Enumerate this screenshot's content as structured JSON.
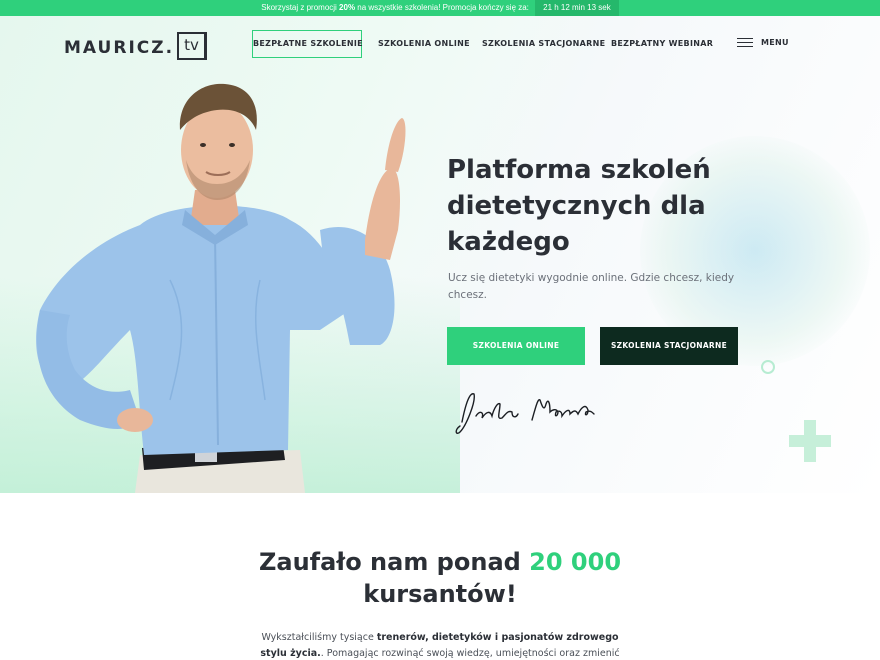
{
  "promo": {
    "text_before": "Skorzystaj z promocji ",
    "discount": "20%",
    "text_after": " na wszystkie szkolenia! Promocja kończy się za:",
    "timer": "21 h 12 min 13 sek"
  },
  "header": {
    "logo_word": "MAURICZ.",
    "logo_tv": "tv",
    "nav": {
      "free_training": "BEZPŁATNE SZKOLENIE",
      "online": "SZKOLENIA  ONLINE",
      "stationary": "SZKOLENIA STACJONARNE",
      "webinar": "BEZPŁATNY WEBINAR",
      "menu": "MENU"
    }
  },
  "hero": {
    "title": "Platforma szkoleń dietetycznych dla każdego",
    "subtitle": "Ucz się dietetyki wygodnie online. Gdzie chcesz, kiedy chcesz.",
    "btn_online": "SZKOLENIA ONLINE",
    "btn_stationary": "SZKOLENIA STACJONARNE"
  },
  "trust": {
    "title_start": "Zaufało nam ponad ",
    "title_number": "20 000",
    "title_end": " kursantów!",
    "text_start": "Wykształciliśmy tysiące ",
    "text_bold": "trenerów, dietetyków i pasjonatów zdrowego stylu życia.",
    "text_end": ". Pomagając rozwinąć swoją wiedzę, umiejętności oraz zmienić swoje"
  },
  "colors": {
    "accent": "#2fd07c",
    "dark_button": "#0d2a1f",
    "text": "#2b2f36"
  }
}
